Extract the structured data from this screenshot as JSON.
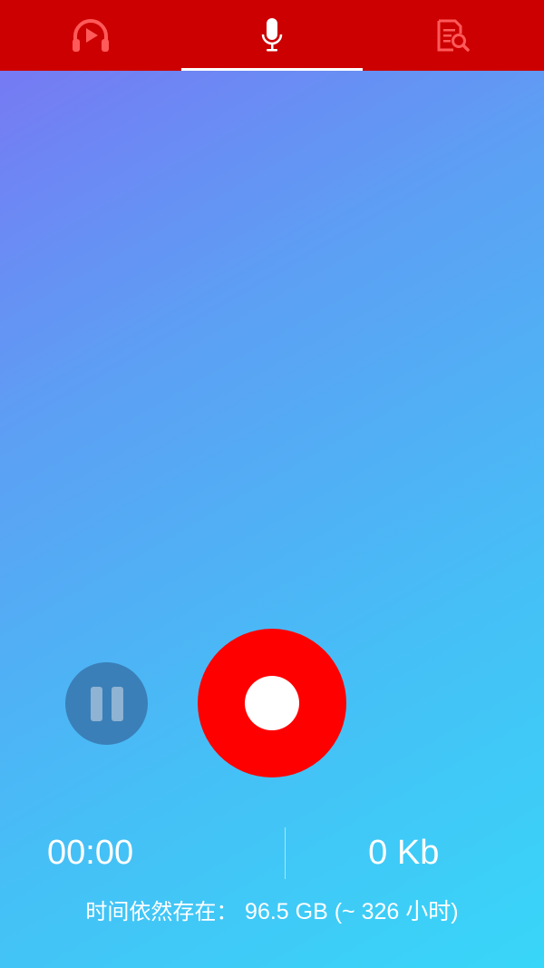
{
  "tabs": [
    {
      "icon": "headphones-play-icon",
      "active": false
    },
    {
      "icon": "microphone-icon",
      "active": true
    },
    {
      "icon": "document-search-icon",
      "active": false
    }
  ],
  "controls": {
    "pause_icon": "pause-icon",
    "record_icon": "record-icon"
  },
  "stats": {
    "elapsed_time": "00:00",
    "file_size": "0 Kb"
  },
  "storage": {
    "label": "时间依然存在：",
    "value": "96.5 GB (~ 326 小时)"
  },
  "colors": {
    "tabbar": "#cc0000",
    "tab_icon_inactive": "#ff5a5a",
    "tab_icon_active": "#ffffff",
    "record_button": "#ff0000",
    "pause_button": "#3a7fb8",
    "gradient_start": "#7b73f3",
    "gradient_end": "#38d6f8"
  }
}
